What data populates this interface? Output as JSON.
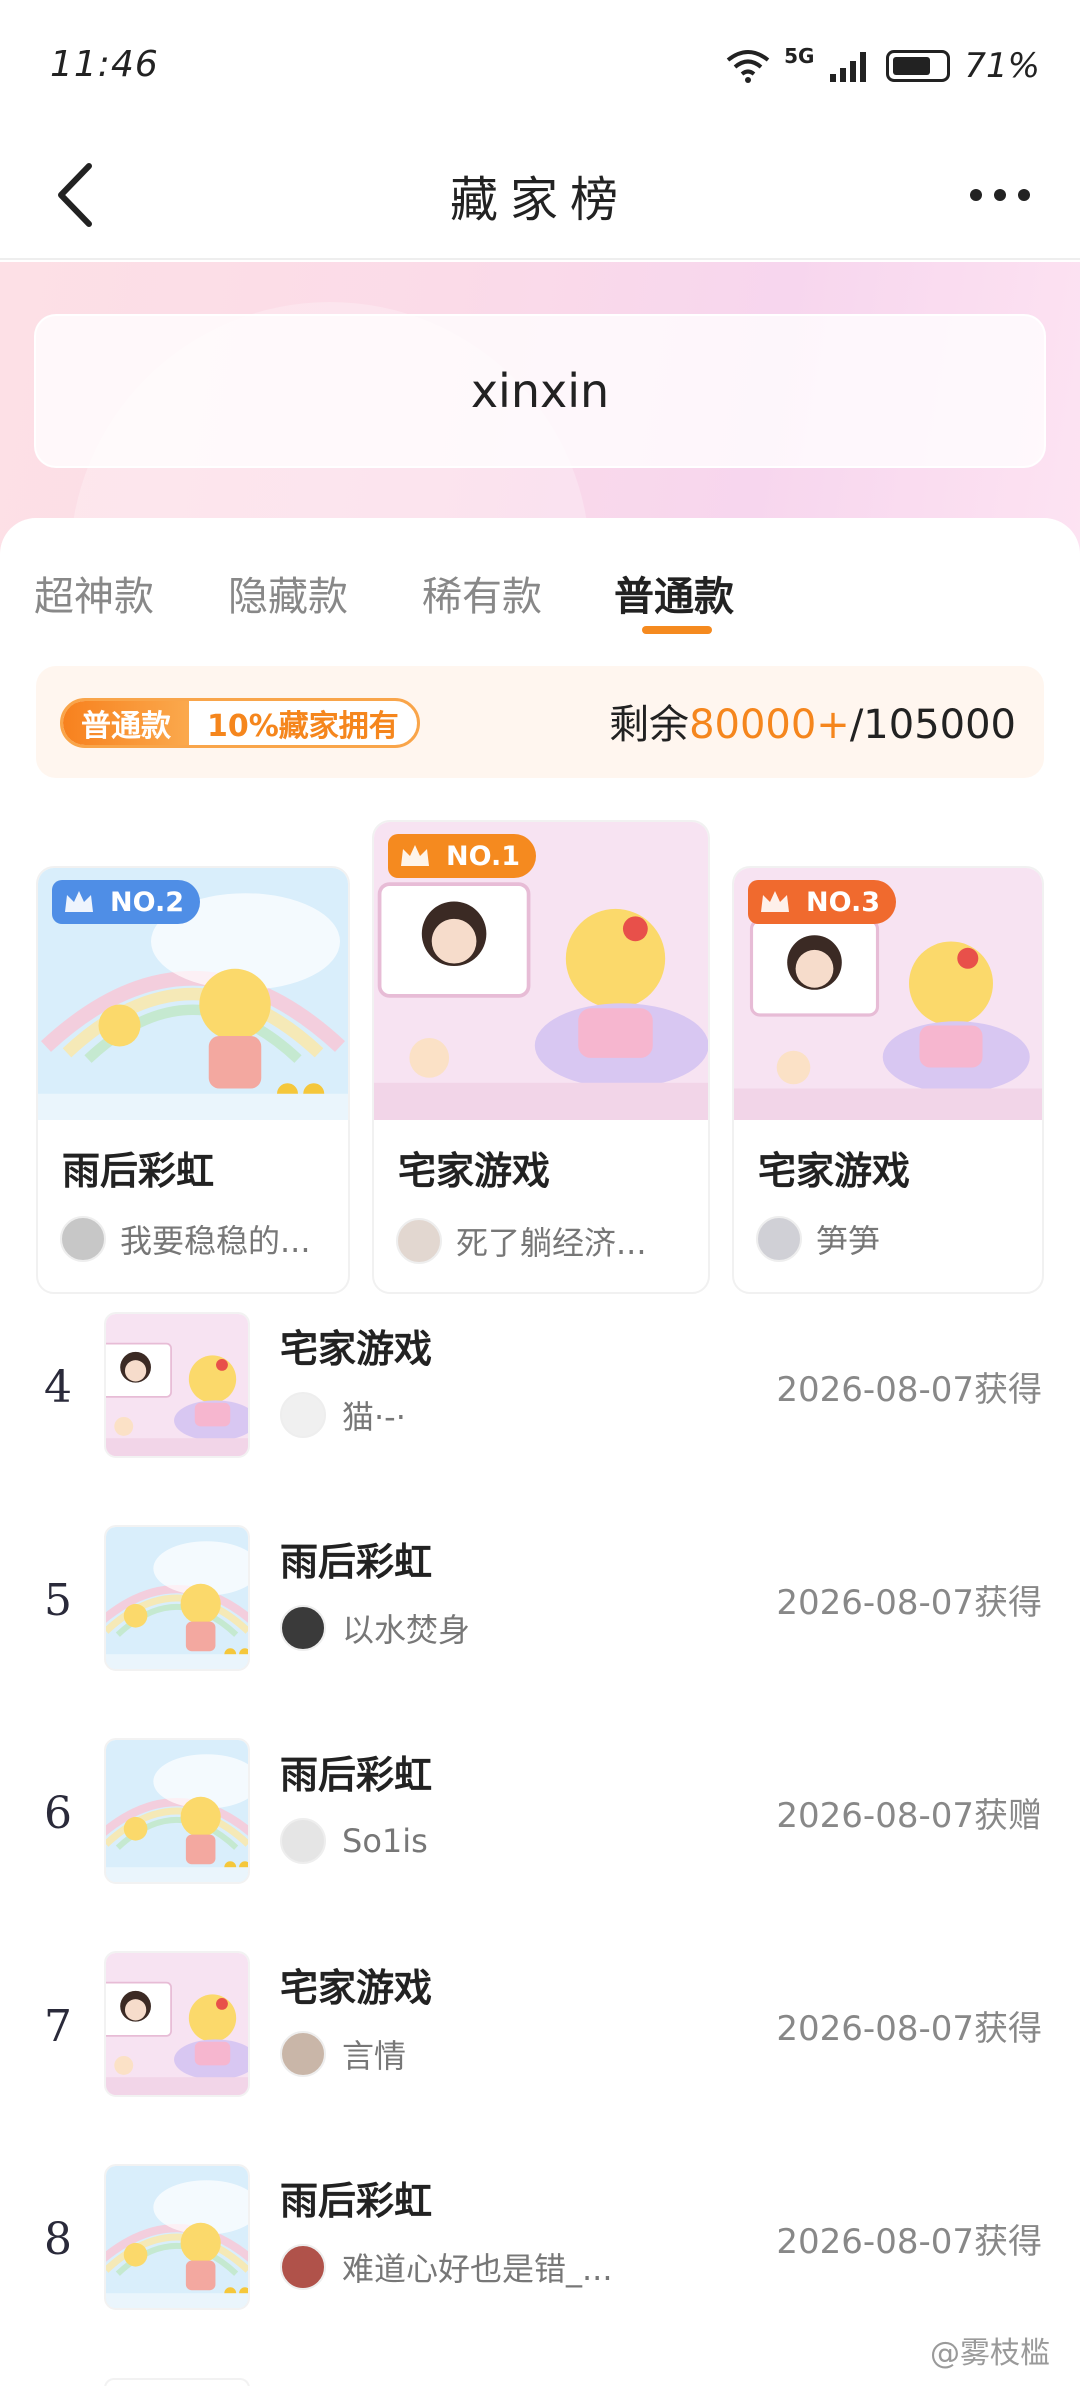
{
  "status": {
    "time": "11:46",
    "network": "5G",
    "battery": "71%",
    "battery_level": 0.71
  },
  "header": {
    "title": "藏家榜"
  },
  "search": {
    "value": "xinxin"
  },
  "tabs": [
    {
      "label": "超神款",
      "active": false
    },
    {
      "label": "隐藏款",
      "active": false
    },
    {
      "label": "稀有款",
      "active": false
    },
    {
      "label": "普通款",
      "active": true
    }
  ],
  "rarity": {
    "tag": "普通款",
    "owned": "10%藏家拥有",
    "remain_prefix": "剩余",
    "remain_count": "80000+",
    "remain_total": "/105000"
  },
  "podium": [
    {
      "badge": "NO.2",
      "title": "雨后彩虹",
      "user": "我要稳稳的...",
      "theme": "rainbow",
      "badge_color": "#4f8ee6"
    },
    {
      "badge": "NO.1",
      "title": "宅家游戏",
      "user": "死了躺经济...",
      "theme": "game",
      "badge_color": "#f58a1f"
    },
    {
      "badge": "NO.3",
      "title": "宅家游戏",
      "user": "笋笋",
      "theme": "game",
      "badge_color": "#f06a2e"
    }
  ],
  "list": [
    {
      "rank": "4",
      "title": "宅家游戏",
      "user": "猫·-·",
      "date": "2026-08-07获得",
      "theme": "game"
    },
    {
      "rank": "5",
      "title": "雨后彩虹",
      "user": "以水焚身",
      "date": "2026-08-07获得",
      "theme": "rainbow"
    },
    {
      "rank": "6",
      "title": "雨后彩虹",
      "user": "So1is",
      "date": "2026-08-07获赠",
      "theme": "rainbow"
    },
    {
      "rank": "7",
      "title": "宅家游戏",
      "user": "言情",
      "date": "2026-08-07获得",
      "theme": "game"
    },
    {
      "rank": "8",
      "title": "雨后彩虹",
      "user": "难道心好也是错_...",
      "date": "2026-08-07获得",
      "theme": "rainbow"
    }
  ],
  "watermark": "@雾枝槛",
  "colors": {
    "accent": "#f58a1f",
    "rainbow_bg": "#d9eefb",
    "game_bg": "#f7e3f2"
  }
}
